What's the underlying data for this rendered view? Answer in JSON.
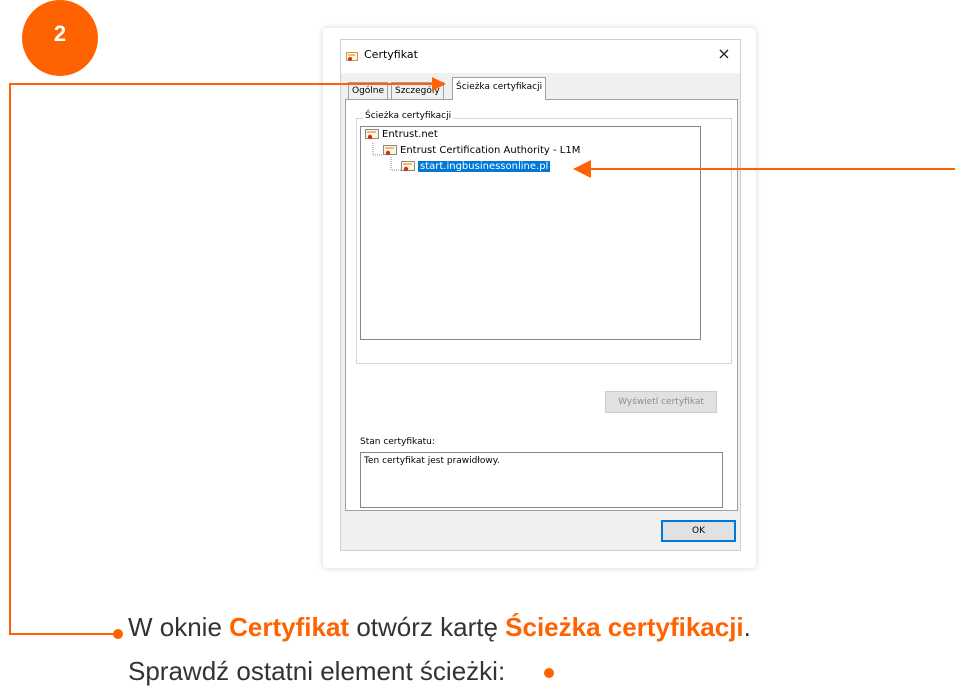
{
  "step": {
    "number": "2"
  },
  "dialog": {
    "title": "Certyfikat",
    "close_glyph": "×",
    "tabs": [
      {
        "label": "Ogólne"
      },
      {
        "label": "Szczegóły"
      },
      {
        "label": "Ścieżka certyfikacji",
        "active": true
      }
    ],
    "path_group_label": "Ścieżka certyfikacji",
    "tree": [
      {
        "label": "Entrust.net"
      },
      {
        "label": "Entrust Certification Authority - L1M"
      },
      {
        "label": "start.ingbusinessonline.pl",
        "selected": true
      }
    ],
    "view_cert_button": "Wyświetl certyfikat",
    "status_label": "Stan certyfikatu:",
    "status_text": "Ten certyfikat jest prawidłowy.",
    "ok_button": "OK"
  },
  "caption": {
    "line1_part1": "W oknie ",
    "line1_hl1": "Certyfikat",
    "line1_part2": " otwórz kartę ",
    "line1_hl2": "Ścieżka certyfikacji",
    "line1_part3": ".",
    "line2": "Sprawdź ostatni element ścieżki:"
  },
  "colors": {
    "accent": "#ff6200",
    "selection": "#0078d7",
    "text": "#333333"
  },
  "icons": [
    "certificate-icon",
    "close-icon",
    "bullet-dot-icon"
  ]
}
